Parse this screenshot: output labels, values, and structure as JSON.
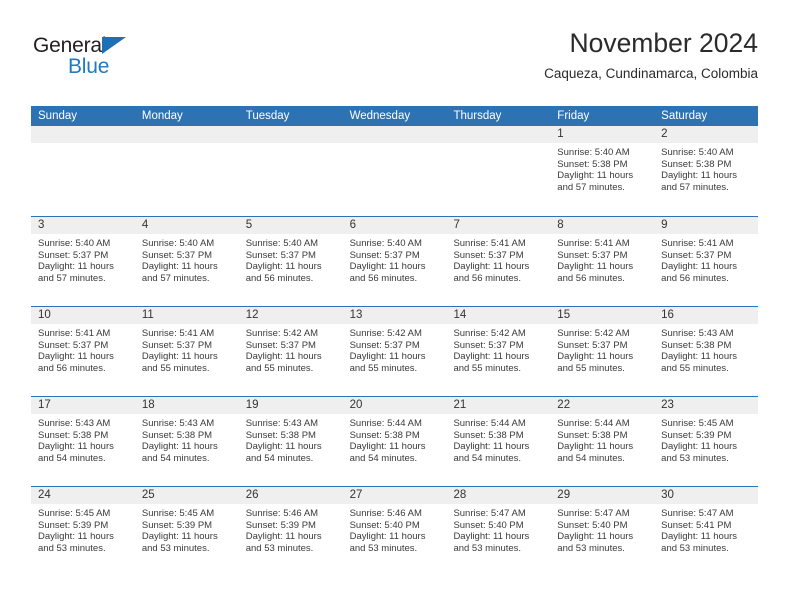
{
  "brand": {
    "name_part1": "General",
    "name_part2": "Blue",
    "triangle_icon": "triangle-icon",
    "accent_color": "#1f7ac4"
  },
  "header": {
    "title": "November 2024",
    "location": "Caqueza, Cundinamarca, Colombia"
  },
  "calendar": {
    "header_color": "#2d72b3",
    "weekdays": [
      "Sunday",
      "Monday",
      "Tuesday",
      "Wednesday",
      "Thursday",
      "Friday",
      "Saturday"
    ],
    "weeks": [
      [
        {
          "day": "",
          "sunrise": "",
          "sunset": "",
          "daylight": ""
        },
        {
          "day": "",
          "sunrise": "",
          "sunset": "",
          "daylight": ""
        },
        {
          "day": "",
          "sunrise": "",
          "sunset": "",
          "daylight": ""
        },
        {
          "day": "",
          "sunrise": "",
          "sunset": "",
          "daylight": ""
        },
        {
          "day": "",
          "sunrise": "",
          "sunset": "",
          "daylight": ""
        },
        {
          "day": "1",
          "sunrise": "Sunrise: 5:40 AM",
          "sunset": "Sunset: 5:38 PM",
          "daylight": "Daylight: 11 hours and 57 minutes."
        },
        {
          "day": "2",
          "sunrise": "Sunrise: 5:40 AM",
          "sunset": "Sunset: 5:38 PM",
          "daylight": "Daylight: 11 hours and 57 minutes."
        }
      ],
      [
        {
          "day": "3",
          "sunrise": "Sunrise: 5:40 AM",
          "sunset": "Sunset: 5:37 PM",
          "daylight": "Daylight: 11 hours and 57 minutes."
        },
        {
          "day": "4",
          "sunrise": "Sunrise: 5:40 AM",
          "sunset": "Sunset: 5:37 PM",
          "daylight": "Daylight: 11 hours and 57 minutes."
        },
        {
          "day": "5",
          "sunrise": "Sunrise: 5:40 AM",
          "sunset": "Sunset: 5:37 PM",
          "daylight": "Daylight: 11 hours and 56 minutes."
        },
        {
          "day": "6",
          "sunrise": "Sunrise: 5:40 AM",
          "sunset": "Sunset: 5:37 PM",
          "daylight": "Daylight: 11 hours and 56 minutes."
        },
        {
          "day": "7",
          "sunrise": "Sunrise: 5:41 AM",
          "sunset": "Sunset: 5:37 PM",
          "daylight": "Daylight: 11 hours and 56 minutes."
        },
        {
          "day": "8",
          "sunrise": "Sunrise: 5:41 AM",
          "sunset": "Sunset: 5:37 PM",
          "daylight": "Daylight: 11 hours and 56 minutes."
        },
        {
          "day": "9",
          "sunrise": "Sunrise: 5:41 AM",
          "sunset": "Sunset: 5:37 PM",
          "daylight": "Daylight: 11 hours and 56 minutes."
        }
      ],
      [
        {
          "day": "10",
          "sunrise": "Sunrise: 5:41 AM",
          "sunset": "Sunset: 5:37 PM",
          "daylight": "Daylight: 11 hours and 56 minutes."
        },
        {
          "day": "11",
          "sunrise": "Sunrise: 5:41 AM",
          "sunset": "Sunset: 5:37 PM",
          "daylight": "Daylight: 11 hours and 55 minutes."
        },
        {
          "day": "12",
          "sunrise": "Sunrise: 5:42 AM",
          "sunset": "Sunset: 5:37 PM",
          "daylight": "Daylight: 11 hours and 55 minutes."
        },
        {
          "day": "13",
          "sunrise": "Sunrise: 5:42 AM",
          "sunset": "Sunset: 5:37 PM",
          "daylight": "Daylight: 11 hours and 55 minutes."
        },
        {
          "day": "14",
          "sunrise": "Sunrise: 5:42 AM",
          "sunset": "Sunset: 5:37 PM",
          "daylight": "Daylight: 11 hours and 55 minutes."
        },
        {
          "day": "15",
          "sunrise": "Sunrise: 5:42 AM",
          "sunset": "Sunset: 5:37 PM",
          "daylight": "Daylight: 11 hours and 55 minutes."
        },
        {
          "day": "16",
          "sunrise": "Sunrise: 5:43 AM",
          "sunset": "Sunset: 5:38 PM",
          "daylight": "Daylight: 11 hours and 55 minutes."
        }
      ],
      [
        {
          "day": "17",
          "sunrise": "Sunrise: 5:43 AM",
          "sunset": "Sunset: 5:38 PM",
          "daylight": "Daylight: 11 hours and 54 minutes."
        },
        {
          "day": "18",
          "sunrise": "Sunrise: 5:43 AM",
          "sunset": "Sunset: 5:38 PM",
          "daylight": "Daylight: 11 hours and 54 minutes."
        },
        {
          "day": "19",
          "sunrise": "Sunrise: 5:43 AM",
          "sunset": "Sunset: 5:38 PM",
          "daylight": "Daylight: 11 hours and 54 minutes."
        },
        {
          "day": "20",
          "sunrise": "Sunrise: 5:44 AM",
          "sunset": "Sunset: 5:38 PM",
          "daylight": "Daylight: 11 hours and 54 minutes."
        },
        {
          "day": "21",
          "sunrise": "Sunrise: 5:44 AM",
          "sunset": "Sunset: 5:38 PM",
          "daylight": "Daylight: 11 hours and 54 minutes."
        },
        {
          "day": "22",
          "sunrise": "Sunrise: 5:44 AM",
          "sunset": "Sunset: 5:38 PM",
          "daylight": "Daylight: 11 hours and 54 minutes."
        },
        {
          "day": "23",
          "sunrise": "Sunrise: 5:45 AM",
          "sunset": "Sunset: 5:39 PM",
          "daylight": "Daylight: 11 hours and 53 minutes."
        }
      ],
      [
        {
          "day": "24",
          "sunrise": "Sunrise: 5:45 AM",
          "sunset": "Sunset: 5:39 PM",
          "daylight": "Daylight: 11 hours and 53 minutes."
        },
        {
          "day": "25",
          "sunrise": "Sunrise: 5:45 AM",
          "sunset": "Sunset: 5:39 PM",
          "daylight": "Daylight: 11 hours and 53 minutes."
        },
        {
          "day": "26",
          "sunrise": "Sunrise: 5:46 AM",
          "sunset": "Sunset: 5:39 PM",
          "daylight": "Daylight: 11 hours and 53 minutes."
        },
        {
          "day": "27",
          "sunrise": "Sunrise: 5:46 AM",
          "sunset": "Sunset: 5:40 PM",
          "daylight": "Daylight: 11 hours and 53 minutes."
        },
        {
          "day": "28",
          "sunrise": "Sunrise: 5:47 AM",
          "sunset": "Sunset: 5:40 PM",
          "daylight": "Daylight: 11 hours and 53 minutes."
        },
        {
          "day": "29",
          "sunrise": "Sunrise: 5:47 AM",
          "sunset": "Sunset: 5:40 PM",
          "daylight": "Daylight: 11 hours and 53 minutes."
        },
        {
          "day": "30",
          "sunrise": "Sunrise: 5:47 AM",
          "sunset": "Sunset: 5:41 PM",
          "daylight": "Daylight: 11 hours and 53 minutes."
        }
      ]
    ]
  }
}
